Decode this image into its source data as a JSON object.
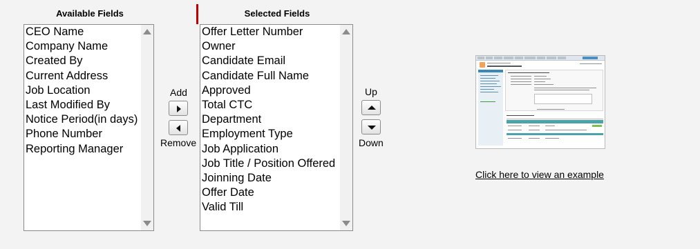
{
  "available": {
    "header": "Available Fields",
    "items": [
      "CEO Name",
      "Company Name",
      "Created By",
      "Current Address",
      "Job Location",
      "Last Modified By",
      "Notice Period(in days)",
      "Phone Number",
      "Reporting Manager"
    ]
  },
  "selected": {
    "header": "Selected Fields",
    "items": [
      "Offer Letter Number",
      "Owner",
      "Candidate Email",
      "Candidate Full Name",
      "Approved",
      "Total CTC",
      "Department",
      "Employment Type",
      "Job Application",
      "Job Title / Position Offered",
      "Joinning Date",
      "Offer Date",
      "Valid Till"
    ]
  },
  "controls": {
    "add_label": "Add",
    "remove_label": "Remove",
    "up_label": "Up",
    "down_label": "Down"
  },
  "example": {
    "link_text": "Click here to view an example"
  },
  "colors": {
    "required_bar": "#c00000",
    "thumbnail_accent": "#4a8fbf"
  }
}
